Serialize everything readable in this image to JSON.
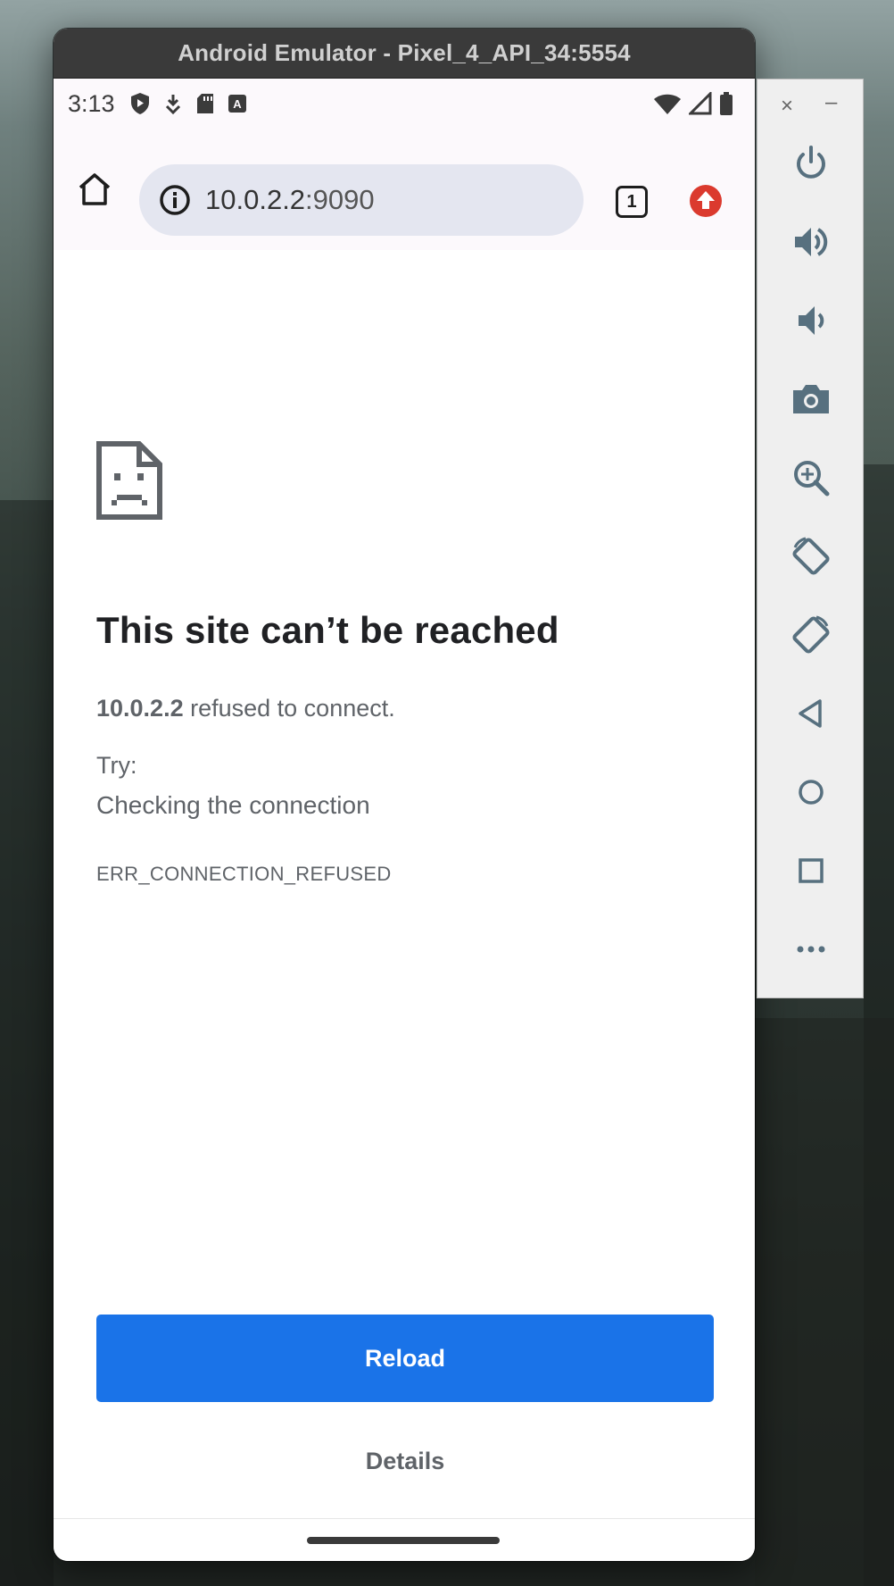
{
  "window": {
    "title": "Android Emulator - Pixel_4_API_34:5554"
  },
  "status_bar": {
    "time": "3:13",
    "icons": [
      "play-protect-icon",
      "download-icon",
      "sd-card-icon",
      "keyboard-a-icon"
    ],
    "right_icons": [
      "wifi-icon",
      "cell-signal-icon",
      "battery-icon"
    ]
  },
  "browser": {
    "home_icon": "home-icon",
    "url_host": "10.0.2.2",
    "url_port": ":9090",
    "tab_count": "1",
    "update_icon": "update-arrow-icon"
  },
  "error_page": {
    "title": "This site can’t be reached",
    "host": "10.0.2.2",
    "description": "refused to connect.",
    "try_label": "Try:",
    "suggestion": "Checking the connection",
    "error_code": "ERR_CONNECTION_REFUSED",
    "reload_label": "Reload",
    "details_label": "Details",
    "accent_color": "#1a73e8"
  },
  "emulator_controls": {
    "close": "×",
    "minimize": "–",
    "buttons": [
      "power-icon",
      "volume-up-icon",
      "volume-down-icon",
      "camera-icon",
      "zoom-icon",
      "rotate-left-icon",
      "rotate-right-icon",
      "back-icon",
      "home-circle-icon",
      "overview-icon",
      "more-icon"
    ]
  }
}
